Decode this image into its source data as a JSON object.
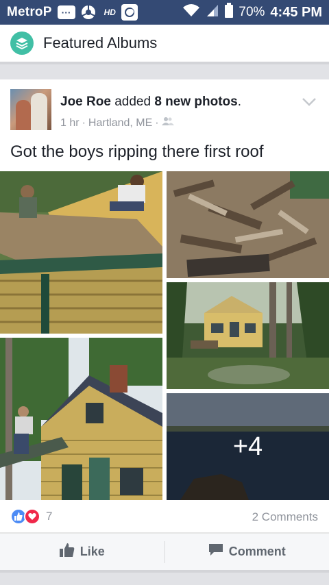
{
  "status_bar": {
    "carrier": "MetroP",
    "network_badge": "HD",
    "battery": "70%",
    "time": "4:45 PM"
  },
  "header": {
    "title": "Featured Albums"
  },
  "post": {
    "author": "Joe Roe",
    "action_text": "added",
    "action_highlight": "8 new photos",
    "action_suffix": ".",
    "time": "1 hr",
    "location": "Hartland, ME",
    "separator": "·",
    "text": "Got the boys ripping there first roof",
    "more_photos": "+4",
    "reaction_count": "7",
    "comments_count": "2 Comments"
  },
  "actions": {
    "like_label": "Like",
    "comment_label": "Comment"
  },
  "colors": {
    "status_bar_bg": "#344a74",
    "accent_teal": "#41bfa5",
    "like_blue": "#4c8bf5",
    "love_red": "#f0284a"
  }
}
